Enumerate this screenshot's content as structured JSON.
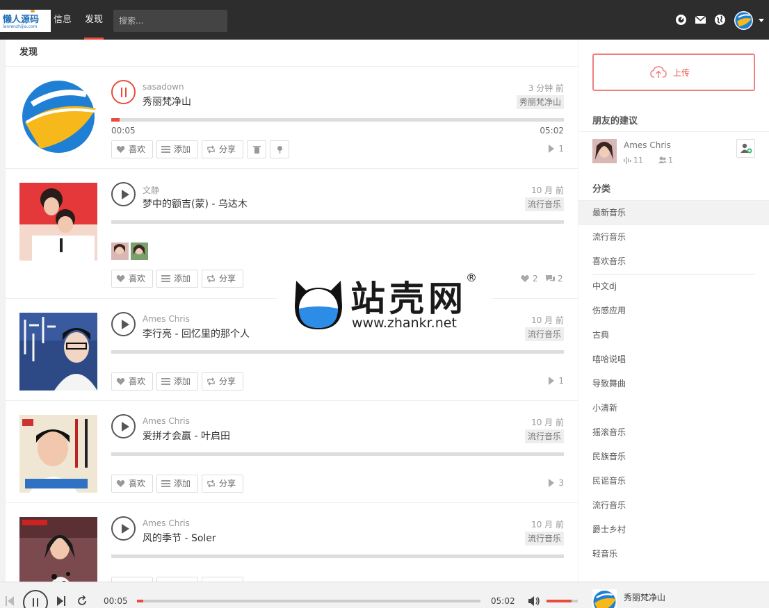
{
  "header": {
    "logo_text": "懒人源码",
    "logo_sub": "lanrenzhijia.com",
    "nav": [
      {
        "label": "信息"
      },
      {
        "label": "发现"
      }
    ],
    "search_placeholder": "搜索..."
  },
  "main": {
    "title": "发现",
    "buttons": {
      "like": "喜欢",
      "add": "添加",
      "share": "分享"
    },
    "tracks": [
      {
        "author": "sasadown",
        "title": "秀丽梵净山",
        "time": "3 分钟 前",
        "tag": "秀丽梵净山",
        "current": "00:05",
        "duration": "05:02",
        "progress": 0.018,
        "plays": "1",
        "playing": true
      },
      {
        "author": "文静",
        "title": "梦中的额吉(蒙) - 乌达木",
        "time": "10 月 前",
        "tag": "流行音乐",
        "likes": "2",
        "comments": "2"
      },
      {
        "author": "Ames Chris",
        "title": "李行亮 - 回忆里的那个人",
        "time": "10 月 前",
        "tag": "流行音乐",
        "plays": "1"
      },
      {
        "author": "Ames Chris",
        "title": "爱拼才会赢 - 叶启田",
        "time": "10 月 前",
        "tag": "流行音乐",
        "plays": "3"
      },
      {
        "author": "Ames Chris",
        "title": "风的季节 - Soler",
        "time": "10 月 前",
        "tag": "流行音乐"
      }
    ]
  },
  "sidebar": {
    "upload_label": "上传",
    "friends_heading": "朋友的建议",
    "friend": {
      "name": "Ames Chris",
      "tracks": "11",
      "followers": "1"
    },
    "categories_heading": "分类",
    "categories": [
      "最新音乐",
      "流行音乐",
      "喜欢音乐",
      "中文dj",
      "伤感应用",
      "古典",
      "嘻哈说唱",
      "导致舞曲",
      "小清新",
      "摇滚音乐",
      "民族音乐",
      "民谣音乐",
      "流行音乐",
      "爵士乡村",
      "轻音乐"
    ]
  },
  "player": {
    "current": "00:05",
    "duration": "05:02",
    "progress": 0.018,
    "volume": 0.8,
    "title": "秀丽梵净山"
  },
  "watermark": {
    "text": "站壳网",
    "url": "www.zhankr.net",
    "mark": "®"
  },
  "colors": {
    "accent": "#e74c3c",
    "topbar": "#2d2d2d",
    "background": "#f2f2f2"
  }
}
